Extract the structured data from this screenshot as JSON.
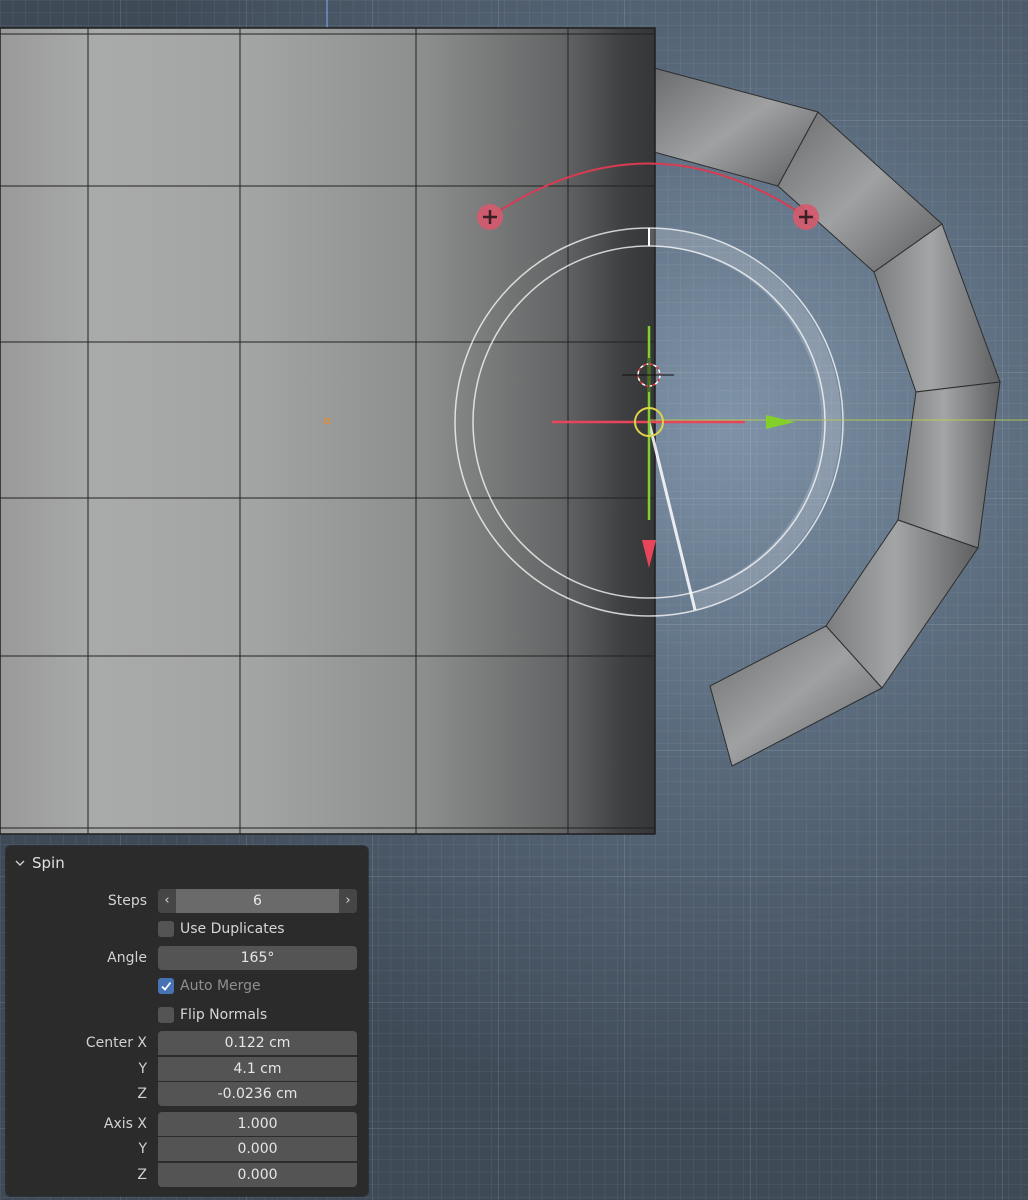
{
  "panel": {
    "title": "Spin",
    "steps": {
      "label": "Steps",
      "value": "6"
    },
    "use_duplicates": {
      "label": "Use Duplicates",
      "checked": false
    },
    "angle": {
      "label": "Angle",
      "value": "165°"
    },
    "auto_merge": {
      "label": "Auto Merge",
      "checked": true
    },
    "flip_normals": {
      "label": "Flip Normals",
      "checked": false
    },
    "center": {
      "x_label": "Center X",
      "x": "0.122 cm",
      "y_label": "Y",
      "y": "4.1 cm",
      "z_label": "Z",
      "z": "-0.0236 cm"
    },
    "axis": {
      "x_label": "Axis X",
      "x": "1.000",
      "y_label": "Y",
      "y": "0.000",
      "z_label": "Z",
      "z": "0.000"
    }
  },
  "colors": {
    "viewport_bg": "#4a5767",
    "x_axis": "#e8455b",
    "y_axis": "#84d02a",
    "gizmo_arc": "#d83c52",
    "checkbox_on": "#4772b3"
  },
  "icons": {
    "collapse": "chevron-down-icon",
    "decrement": "chevron-left-icon",
    "increment": "chevron-right-icon",
    "checked": "checkmark-icon"
  }
}
